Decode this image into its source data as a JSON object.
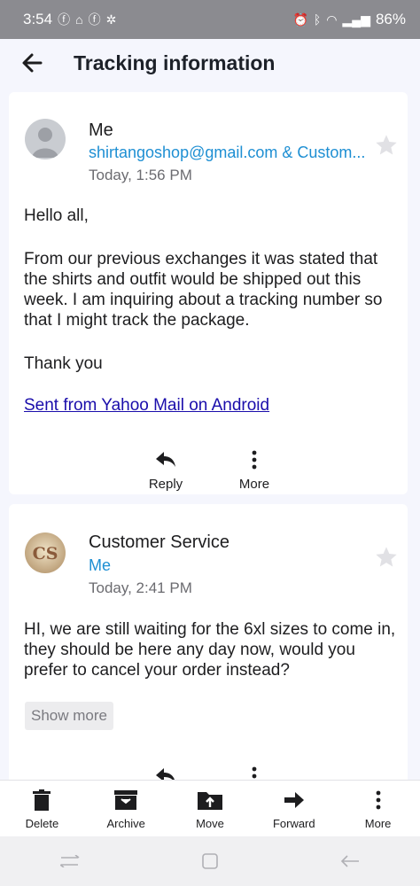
{
  "status_bar": {
    "time": "3:54",
    "battery": "86%"
  },
  "header": {
    "title": "Tracking information"
  },
  "messages": [
    {
      "sender": "Me",
      "recipients": "shirtangoshop@gmail.com & Custom...",
      "time": "Today, 1:56 PM",
      "greeting": "Hello all,",
      "paragraph": "From our previous exchanges it was stated that the shirts and outfit would be shipped out this week. I am inquiring about a tracking number so that I might track the package.",
      "closing": "Thank you",
      "signature_link": "Sent from Yahoo Mail on Android",
      "actions": {
        "reply": "Reply",
        "more": "More"
      }
    },
    {
      "sender": "Customer Service",
      "avatar_initials": "CS",
      "recipients": "Me",
      "time": "Today, 2:41 PM",
      "paragraph": "HI, we are still waiting for the 6xl sizes to come in, they should be here any day now, would you prefer to cancel your order instead?",
      "show_more": "Show more"
    }
  ],
  "toolbar": {
    "delete": "Delete",
    "archive": "Archive",
    "move": "Move",
    "forward": "Forward",
    "more": "More"
  },
  "icons": [
    "back-arrow-icon",
    "star-icon",
    "reply-icon",
    "more-vertical-icon",
    "trash-icon",
    "archive-icon",
    "move-folder-icon",
    "forward-icon"
  ],
  "colors": {
    "link": "#1e8fd3",
    "status_bar": "#8b8b90",
    "background": "#f5f6fd"
  }
}
